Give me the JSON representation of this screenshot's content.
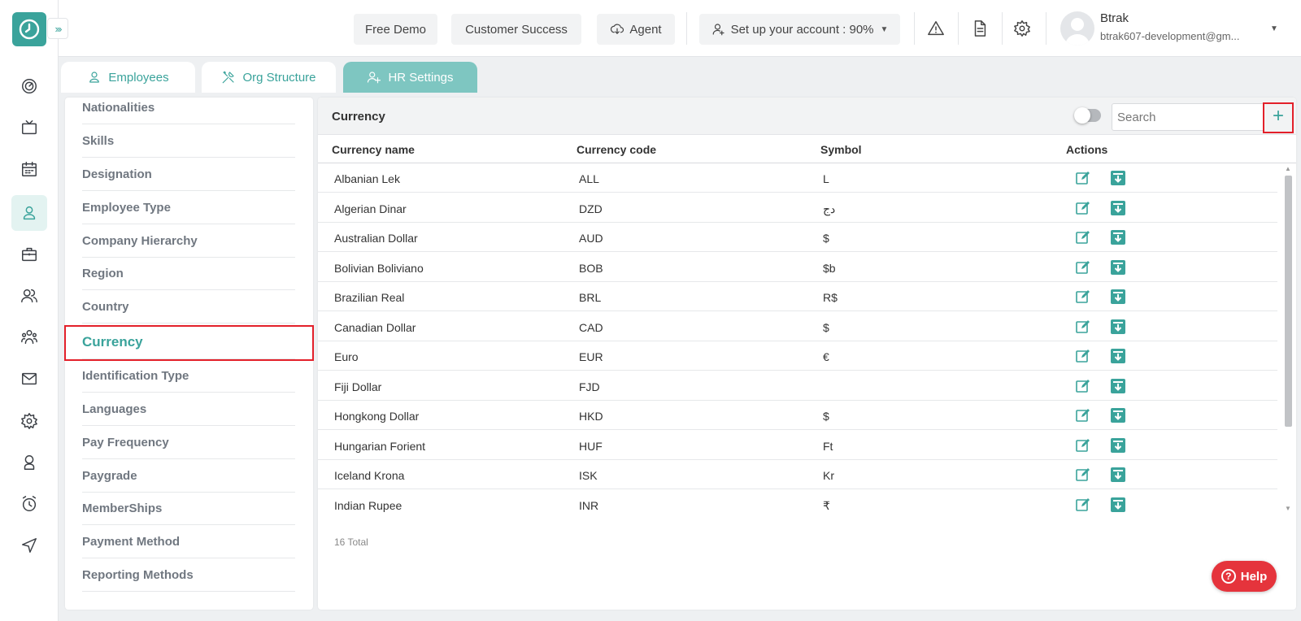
{
  "topbar": {
    "free_demo": "Free Demo",
    "customer_success": "Customer Success",
    "agent": "Agent",
    "setup": "Set up your account : 90%",
    "user_name": "Btrak",
    "user_email": "btrak607-development@gm..."
  },
  "sidebar_icons": [
    "dashboard-icon",
    "tv-icon",
    "calendar-icon",
    "user-icon",
    "briefcase-icon",
    "users-icon",
    "team-icon",
    "mail-icon",
    "settings-icon",
    "badge-icon",
    "alarm-icon",
    "send-icon"
  ],
  "tabs": [
    {
      "label": "Employees"
    },
    {
      "label": "Org Structure"
    },
    {
      "label": "HR Settings"
    }
  ],
  "settings_menu": {
    "items": [
      "Nationalities",
      "Skills",
      "Designation",
      "Employee Type",
      "Company Hierarchy",
      "Region",
      "Country",
      "Currency",
      "Identification Type",
      "Languages",
      "Pay Frequency",
      "Paygrade",
      "MemberShips",
      "Payment Method",
      "Reporting Methods"
    ],
    "active": "Currency"
  },
  "panel": {
    "title": "Currency",
    "search_placeholder": "Search",
    "add_label": "+",
    "columns": [
      "Currency name",
      "Currency code",
      "Symbol",
      "Actions"
    ],
    "rows": [
      {
        "name": "Albanian Lek",
        "code": "ALL",
        "symbol": "L"
      },
      {
        "name": "Algerian Dinar",
        "code": "DZD",
        "symbol": "دج"
      },
      {
        "name": "Australian Dollar",
        "code": "AUD",
        "symbol": "$"
      },
      {
        "name": "Bolivian Boliviano",
        "code": "BOB",
        "symbol": "$b"
      },
      {
        "name": "Brazilian Real",
        "code": "BRL",
        "symbol": "R$"
      },
      {
        "name": "Canadian Dollar",
        "code": "CAD",
        "symbol": "$"
      },
      {
        "name": "Euro",
        "code": "EUR",
        "symbol": "€"
      },
      {
        "name": "Fiji Dollar",
        "code": "FJD",
        "symbol": ""
      },
      {
        "name": "Hongkong Dollar",
        "code": "HKD",
        "symbol": "$"
      },
      {
        "name": "Hungarian Forient",
        "code": "HUF",
        "symbol": "Ft"
      },
      {
        "name": "Iceland Krona",
        "code": "ISK",
        "symbol": "Kr"
      },
      {
        "name": "Indian Rupee",
        "code": "INR",
        "symbol": "₹"
      }
    ],
    "total": "16 Total"
  },
  "help": {
    "label": "Help"
  },
  "colors": {
    "accent": "#3aa39b",
    "highlight": "#e3202a",
    "help": "#e5343c"
  }
}
